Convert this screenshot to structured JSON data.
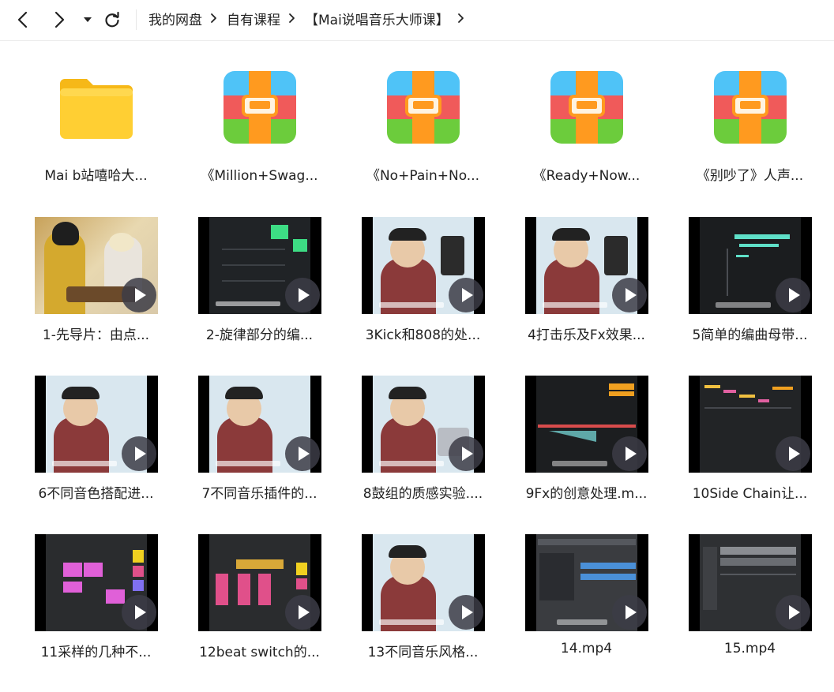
{
  "breadcrumb": {
    "items": [
      "我的网盘",
      "自有课程",
      "【Mai说唱音乐大师课】"
    ]
  },
  "icons": {
    "back": "chevron-left-icon",
    "forward": "chevron-right-icon",
    "history": "caret-down-icon",
    "refresh": "refresh-icon",
    "folder": "folder-icon",
    "archive": "zip-archive-icon",
    "play": "play-icon"
  },
  "colors": {
    "folder": "#ffc928",
    "zip_blue": "#4fc3f7",
    "zip_red": "#f05a5a",
    "zip_green": "#6ccc3c",
    "zip_orange": "#ff9a1f"
  },
  "folders": [
    {
      "name": "Mai  b站嘻哈大..."
    }
  ],
  "archives": [
    {
      "name": "《Million+Swag..."
    },
    {
      "name": "《No+Pain+No..."
    },
    {
      "name": "《Ready+Now..."
    },
    {
      "name": "《别吵了》人声..."
    }
  ],
  "videos": [
    {
      "name": "1-先导片：由点..."
    },
    {
      "name": "2-旋律部分的编..."
    },
    {
      "name": "3Kick和808的处..."
    },
    {
      "name": "4打击乐及Fx效果..."
    },
    {
      "name": "5简单的编曲母带..."
    },
    {
      "name": "6不同音色搭配进..."
    },
    {
      "name": "7不同音乐插件的..."
    },
    {
      "name": "8鼓组的质感实验...."
    },
    {
      "name": "9Fx的创意处理.m..."
    },
    {
      "name": "10Side Chain让..."
    },
    {
      "name": "11采样的几种不..."
    },
    {
      "name": "12beat switch的..."
    },
    {
      "name": "13不同音乐风格..."
    },
    {
      "name": "14.mp4"
    },
    {
      "name": "15.mp4"
    }
  ]
}
